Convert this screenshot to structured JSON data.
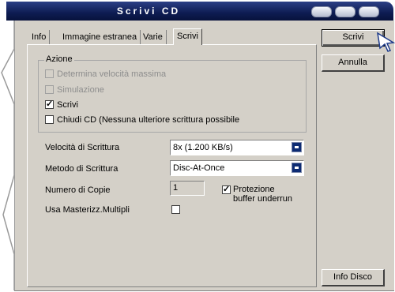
{
  "window": {
    "title": "Scrivi CD"
  },
  "tabs": [
    {
      "label": "Info"
    },
    {
      "label": "Immagine estranea"
    },
    {
      "label": "Varie"
    },
    {
      "label": "Scrivi",
      "active": true
    }
  ],
  "action_group": {
    "legend": "Azione",
    "options": [
      {
        "label": "Determina velocità massima",
        "checked": false,
        "enabled": false
      },
      {
        "label": "Simulazione",
        "checked": false,
        "enabled": false
      },
      {
        "label": "Scrivi",
        "checked": true,
        "enabled": true
      },
      {
        "label": "Chiudi CD (Nessuna ulteriore scrittura possibile",
        "checked": false,
        "enabled": true
      }
    ]
  },
  "fields": {
    "speed_label": "Velocità di Scrittura",
    "speed_value": "8x (1.200 KB/s)",
    "method_label": "Metodo di Scrittura",
    "method_value": "Disc-At-Once",
    "copies_label": "Numero di Copie",
    "copies_value": "1",
    "buffer_protection_label_1": "Protezione",
    "buffer_protection_label_2": "buffer underrun",
    "buffer_protection_checked": true,
    "multi_recorder_label": "Usa Masterizz.Multipli",
    "multi_recorder_checked": false
  },
  "buttons": {
    "write": "Scrivi",
    "cancel": "Annulla",
    "disc_info": "Info Disco"
  },
  "colors": {
    "titlebar": "#0e1c52",
    "panel": "#d4d0c8",
    "combo_button": "#0d2b73"
  }
}
